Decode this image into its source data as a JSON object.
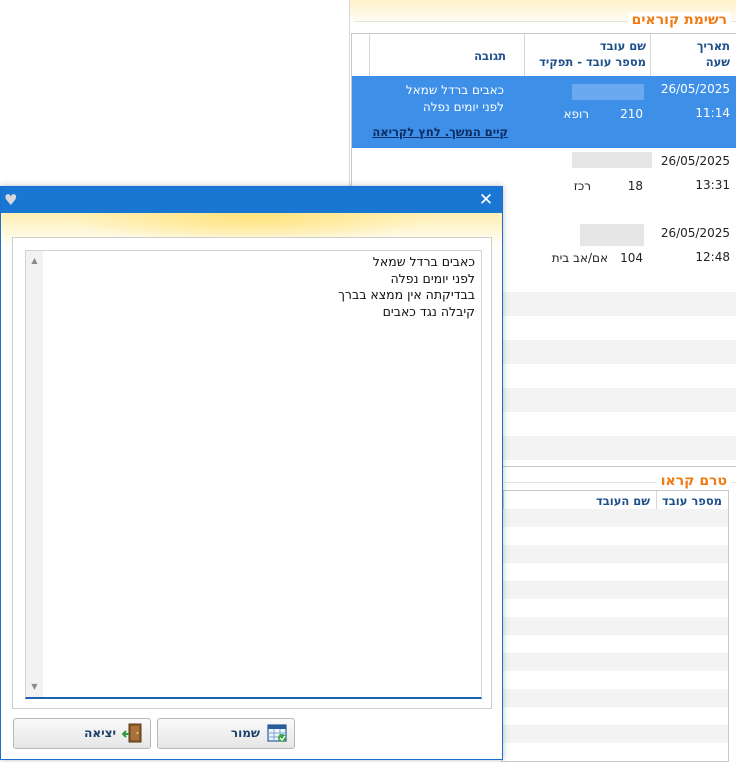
{
  "readers_section": {
    "title": "רשימת קוראים",
    "headers": {
      "date": "תאריך",
      "time": "שעה",
      "employee_name": "שם עובד",
      "employee_number_role": "מספר עובד - תפקיד",
      "response": "תגובה"
    },
    "rows": [
      {
        "date": "26/05/2025",
        "time": "11:14",
        "employee_number": "210",
        "role": "רופא",
        "response_line1": "כאבים ברדל שמאל",
        "response_line2": "לפני יומים נפלה",
        "more_link": "קיים המשך. לחץ לקריאה",
        "selected": true
      },
      {
        "date": "26/05/2025",
        "time": "13:31",
        "employee_number": "18",
        "role": "רכז"
      },
      {
        "date": "26/05/2025",
        "time": "12:48",
        "employee_number": "104",
        "role": "אם/אב בית"
      }
    ]
  },
  "unread_section": {
    "title": "טרם קראו",
    "headers": {
      "employee_number": "מספר עובד",
      "employee_name": "שם העובד"
    }
  },
  "dialog": {
    "text": "כאבים ברדל שמאל\nלפני יומים נפלה\nבבדיקתה אין ממצא בברך\nקיבלה נגד כאבים",
    "save_label": "שמור",
    "exit_label": "יציאה"
  },
  "colors": {
    "titlebar": "#1976d2",
    "selected_row": "#3d8fe8",
    "section_title": "#f07a14",
    "header_text": "#1d4f8a"
  }
}
